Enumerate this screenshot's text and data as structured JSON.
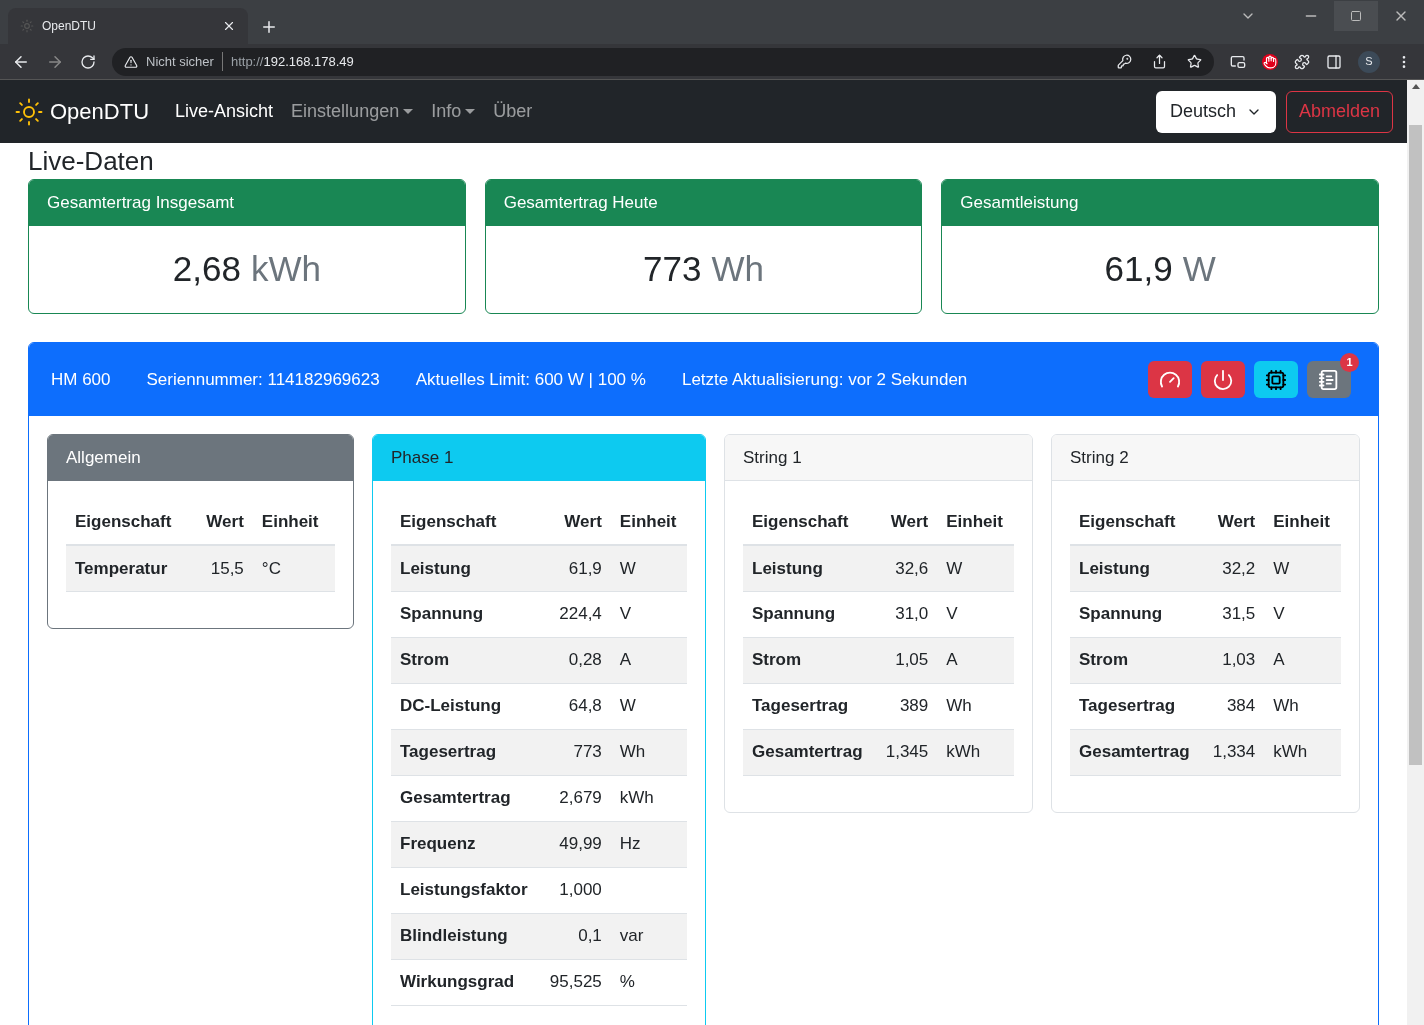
{
  "browser": {
    "tab_title": "OpenDTU",
    "security": "Nicht sicher",
    "url_scheme": "http://",
    "url_host": "192.168.178.49",
    "avatar": "S"
  },
  "navbar": {
    "brand": "OpenDTU",
    "items": [
      {
        "label": "Live-Ansicht",
        "selected": true,
        "dropdown": false
      },
      {
        "label": "Einstellungen",
        "selected": false,
        "dropdown": true
      },
      {
        "label": "Info",
        "selected": false,
        "dropdown": true
      },
      {
        "label": "Über",
        "selected": false,
        "dropdown": false
      }
    ],
    "language": "Deutsch",
    "logout": "Abmelden"
  },
  "heading": "Live-Daten",
  "totals": [
    {
      "title": "Gesamtertrag Insgesamt",
      "value": "2,68",
      "unit": "kWh"
    },
    {
      "title": "Gesamtertrag Heute",
      "value": "773",
      "unit": "Wh"
    },
    {
      "title": "Gesamtleistung",
      "value": "61,9",
      "unit": "W"
    }
  ],
  "inverter": {
    "name": "HM 600",
    "serial": "Seriennummer: 114182969623",
    "limit": "Aktuelles Limit: 600 W | 100 %",
    "updated": "Letzte Aktualisierung: vor 2 Sekunden",
    "actions": [
      {
        "kind": "limit",
        "color": "#dc3545"
      },
      {
        "kind": "power",
        "color": "#dc3545"
      },
      {
        "kind": "device",
        "color": "#0dcaf0"
      },
      {
        "kind": "events",
        "color": "#6c757d",
        "badge": "1"
      }
    ],
    "panels": [
      {
        "title": "Allgemein",
        "kind": "secondary",
        "columns": [
          "Eigenschaft",
          "Wert",
          "Einheit"
        ],
        "rows": [
          [
            "Temperatur",
            "15,5",
            "°C"
          ]
        ]
      },
      {
        "title": "Phase 1",
        "kind": "info",
        "columns": [
          "Eigenschaft",
          "Wert",
          "Einheit"
        ],
        "rows": [
          [
            "Leistung",
            "61,9",
            "W"
          ],
          [
            "Spannung",
            "224,4",
            "V"
          ],
          [
            "Strom",
            "0,28",
            "A"
          ],
          [
            "DC-Leistung",
            "64,8",
            "W"
          ],
          [
            "Tagesertrag",
            "773",
            "Wh"
          ],
          [
            "Gesamtertrag",
            "2,679",
            "kWh"
          ],
          [
            "Frequenz",
            "49,99",
            "Hz"
          ],
          [
            "Leistungsfaktor",
            "1,000"
          ],
          [
            "Blindleistung",
            "0,1",
            "var"
          ],
          [
            "Wirkungsgrad",
            "95,525",
            "%"
          ]
        ]
      },
      {
        "title": "String 1",
        "kind": "light",
        "columns": [
          "Eigenschaft",
          "Wert",
          "Einheit"
        ],
        "rows": [
          [
            "Leistung",
            "32,6",
            "W"
          ],
          [
            "Spannung",
            "31,0",
            "V"
          ],
          [
            "Strom",
            "1,05",
            "A"
          ],
          [
            "Tagesertrag",
            "389",
            "Wh"
          ],
          [
            "Gesamtertrag",
            "1,345",
            "kWh"
          ]
        ]
      },
      {
        "title": "String 2",
        "kind": "light",
        "columns": [
          "Eigenschaft",
          "Wert",
          "Einheit"
        ],
        "rows": [
          [
            "Leistung",
            "32,2",
            "W"
          ],
          [
            "Spannung",
            "31,5",
            "V"
          ],
          [
            "Strom",
            "1,03",
            "A"
          ],
          [
            "Tagesertrag",
            "384",
            "Wh"
          ],
          [
            "Gesamtertrag",
            "1,334",
            "kWh"
          ]
        ]
      }
    ]
  }
}
